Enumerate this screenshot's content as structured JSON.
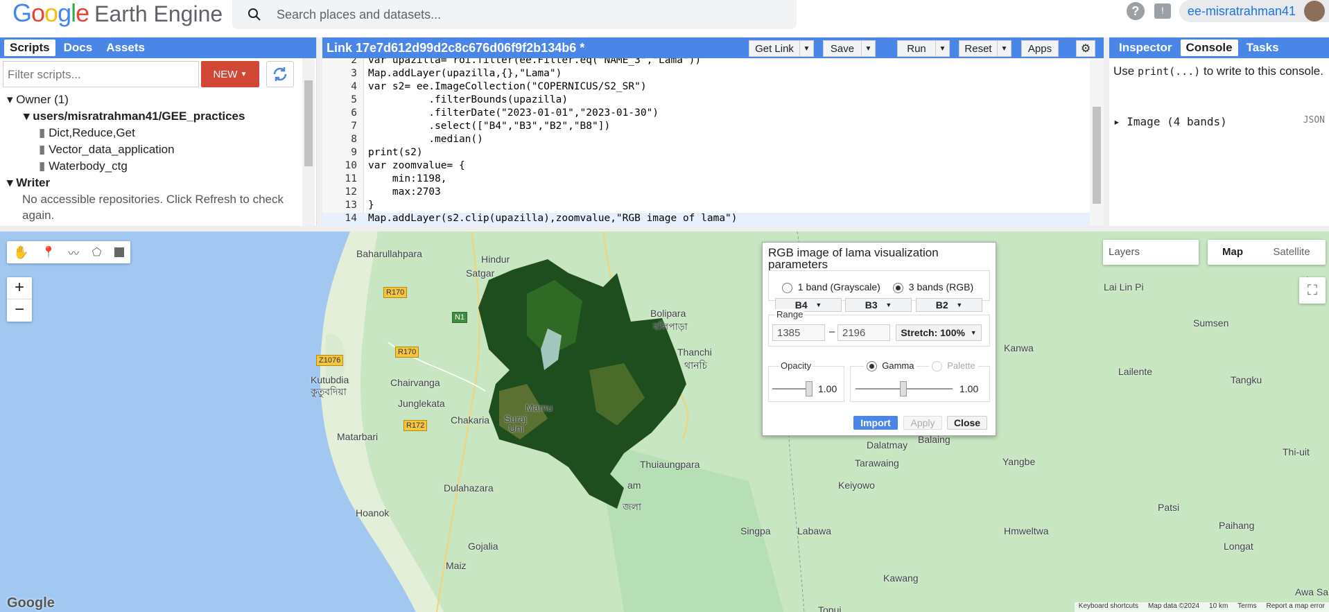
{
  "header": {
    "logo_google": "Google",
    "logo_product": "Earth Engine",
    "search_placeholder": "Search places and datasets...",
    "account": "ee-misratrahman41"
  },
  "left_panel": {
    "tabs": [
      "Scripts",
      "Docs",
      "Assets"
    ],
    "filter_placeholder": "Filter scripts...",
    "new_label": "NEW",
    "owner": "Owner (1)",
    "repo": "users/misratrahman41/GEE_practices",
    "files": [
      "Dict,Reduce,Get",
      "Vector_data_application",
      "Waterbody_ctg"
    ],
    "writer": "Writer",
    "writer_msg": "No accessible repositories. Click Refresh to check again."
  },
  "editor": {
    "title": "Link 17e7d612d99d2c8c676d06f9f2b134b6 *",
    "buttons": {
      "get_link": "Get Link",
      "save": "Save",
      "run": "Run",
      "reset": "Reset",
      "apps": "Apps"
    },
    "lines": [
      {
        "n": "2",
        "text": "var upazilla= roi.filter(ee.Filter.eq(\"NAME_3\",\"Lama\"))"
      },
      {
        "n": "3",
        "text": "Map.addLayer(upazilla,{},\"Lama\")"
      },
      {
        "n": "4",
        "text": "var s2= ee.ImageCollection(\"COPERNICUS/S2_SR\")"
      },
      {
        "n": "5",
        "text": "          .filterBounds(upazilla)"
      },
      {
        "n": "6",
        "text": "          .filterDate(\"2023-01-01\",\"2023-01-30\")"
      },
      {
        "n": "7",
        "text": "          .select([\"B4\",\"B3\",\"B2\",\"B8\"])"
      },
      {
        "n": "8",
        "text": "          .median()"
      },
      {
        "n": "9",
        "text": "print(s2)"
      },
      {
        "n": "10",
        "text": "var zoomvalue= {"
      },
      {
        "n": "11",
        "text": "    min:1198,"
      },
      {
        "n": "12",
        "text": "    max:2703"
      },
      {
        "n": "13",
        "text": "}"
      },
      {
        "n": "14",
        "text": "Map.addLayer(s2.clip(upazilla),zoomvalue,\"RGB image of lama\")"
      }
    ]
  },
  "right_panel": {
    "tabs": [
      "Inspector",
      "Console",
      "Tasks"
    ],
    "hint_pre": "Use ",
    "hint_code": "print(...)",
    "hint_post": " to write to this console.",
    "output": "Image (4 bands)",
    "json_label": "JSON"
  },
  "map": {
    "layers_label": "Layers",
    "map_label": "Map",
    "satellite_label": "Satellite",
    "zoom_in": "+",
    "zoom_out": "−",
    "places": [
      "Baharullahpara",
      "Hindur",
      "Satgar",
      "Bolipara",
      "বলিপাড়া",
      "Thanchi",
      "থানচি",
      "Kutubdia",
      "কুতুবদিয়া",
      "Chairvanga",
      "Junglekata",
      "Chakaria",
      "Matarbari",
      "Dulahazara",
      "Hoanok",
      "Gojalia",
      "Maiz",
      "Thuiaungpara",
      "Kanwa",
      "Sumsen",
      "Lailente",
      "Tangku",
      "Lai Lin Pi",
      "Dalatmay",
      "Balaing",
      "Tarawaing",
      "Keiyowo",
      "Yangbe",
      "Thi-uit",
      "Patsi",
      "Paihang",
      "Longat",
      "Singpa",
      "Labawa",
      "Hmweltwa",
      "Kawang",
      "Awa Sa",
      "Lun",
      "Mamu",
      "Suraj",
      "Uni",
      "am",
      "জলা",
      "Topui"
    ],
    "roads": [
      "R170",
      "N1",
      "R170",
      "Z1076",
      "R172"
    ],
    "google_mark": "Google",
    "footer": [
      "Keyboard shortcuts",
      "Map data ©2024",
      "10 km",
      "Terms",
      "Report a map error"
    ]
  },
  "viz": {
    "title": "RGB image of lama visualization parameters",
    "band1": "1 band (Grayscale)",
    "band3": "3 bands (RGB)",
    "bands": [
      "B4",
      "B3",
      "B2"
    ],
    "range_label": "Range",
    "range_min": "1385",
    "range_dash": "–",
    "range_max": "2196",
    "stretch": "Stretch: 100%",
    "opacity_label": "Opacity",
    "opacity_value": "1.00",
    "gamma_label": "Gamma",
    "palette_label": "Palette",
    "gamma_value": "1.00",
    "import": "Import",
    "apply": "Apply",
    "close": "Close"
  }
}
